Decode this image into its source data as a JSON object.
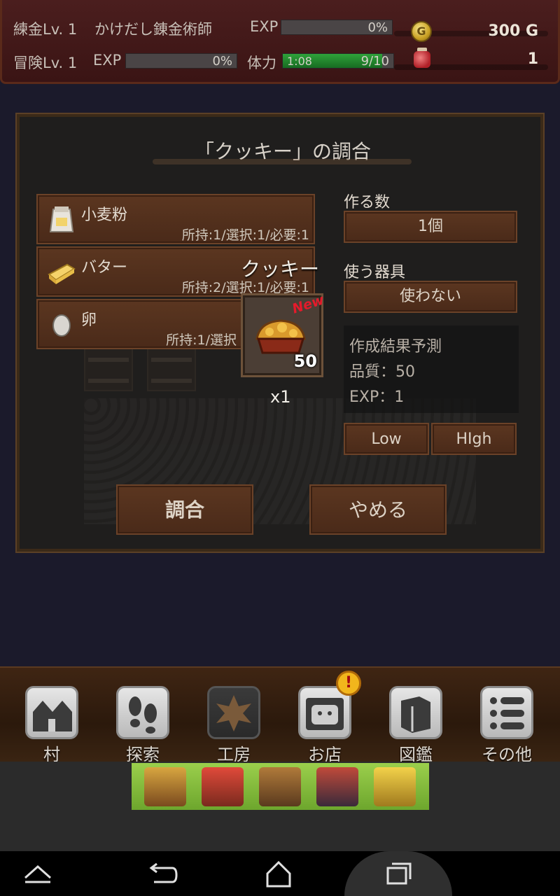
{
  "header": {
    "alchemy_level": "練金Lv. 1",
    "alchemist_title": "かけだし錬金術師",
    "alchemy_exp_label": "EXP",
    "alchemy_exp_value": "0%",
    "alchemy_exp_fraction": 0,
    "adventure_level": "冒険Lv. 1",
    "adventure_exp_label": "EXP",
    "adventure_exp_value": "0%",
    "adventure_exp_fraction": 0,
    "stamina_label": "体力",
    "stamina_timer": "1:08",
    "stamina_value": "9/10",
    "stamina_fraction": 0.9,
    "gold_icon": "gold-coin-icon",
    "coin_glyph": "G",
    "gold_amount": "300 G",
    "potion_icon": "potion-jar-icon",
    "potion_amount": "1"
  },
  "dialog": {
    "title": "「クッキー」の調合",
    "ingredients": [
      {
        "name": "小麦粉",
        "detail": "所持:1/選択:1/必要:1",
        "icon": "flour-bag-icon"
      },
      {
        "name": "バター",
        "detail": "所持:2/選択:1/必要:1",
        "icon": "butter-icon"
      },
      {
        "name": "卵",
        "detail": "所持:1/選択",
        "icon": "egg-icon"
      }
    ],
    "quantity_label": "作る数",
    "quantity_value": "1個",
    "tool_label": "使う器具",
    "tool_value": "使わない",
    "prediction_title": "作成結果予測",
    "prediction_quality": "品質：50",
    "prediction_exp": "EXP：1",
    "low_label": "Low",
    "high_label": "HIgh",
    "craft_label": "調合",
    "cancel_label": "やめる",
    "result": {
      "name": "クッキー",
      "badge": "New",
      "quality": "50",
      "count": "x1",
      "icon": "cookie-icon"
    }
  },
  "nav": [
    {
      "label": "村",
      "icon": "village-icon"
    },
    {
      "label": "探索",
      "icon": "footprints-icon"
    },
    {
      "label": "工房",
      "icon": "workshop-icon"
    },
    {
      "label": "お店",
      "icon": "shop-icon",
      "badge": "!"
    },
    {
      "label": "図鑑",
      "icon": "book-icon"
    },
    {
      "label": "その他",
      "icon": "menu-list-icon"
    }
  ],
  "system_bar": {
    "home_up_icon": "chevron-up-icon",
    "back_icon": "back-icon",
    "home_icon": "home-icon",
    "recents_icon": "recents-icon"
  }
}
